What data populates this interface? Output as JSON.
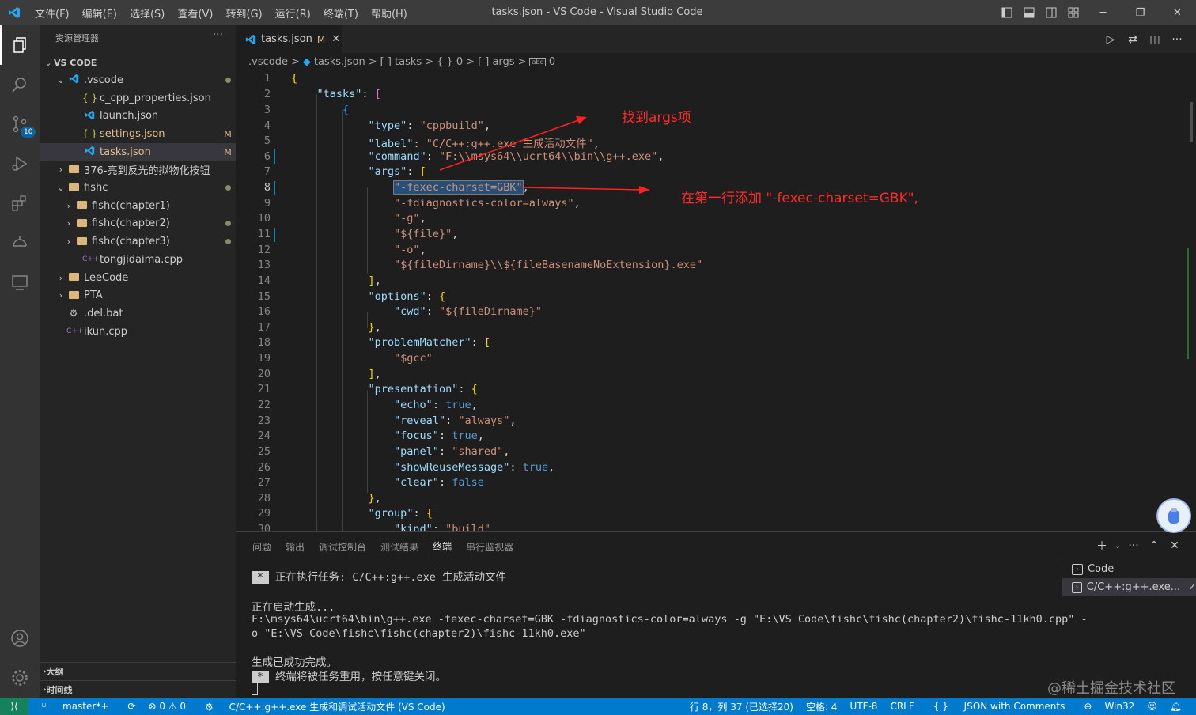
{
  "titlebar": {
    "menus": [
      "文件(F)",
      "编辑(E)",
      "选择(S)",
      "查看(V)",
      "转到(G)",
      "运行(R)",
      "终端(T)",
      "帮助(H)"
    ],
    "title": "tasks.json - VS Code - Visual Studio Code"
  },
  "activity": {
    "scm_badge": "10"
  },
  "sidebar": {
    "title": "资源管理器",
    "root": "VS CODE",
    "items": [
      {
        "label": ".vscode",
        "dec": "●"
      },
      {
        "label": "c_cpp_properties.json",
        "icon": "{ }",
        "dec": ""
      },
      {
        "label": "launch.json",
        "dec": ""
      },
      {
        "label": "settings.json",
        "icon": "{ }",
        "dec": "M"
      },
      {
        "label": "tasks.json",
        "dec": "M"
      },
      {
        "label": "376-亮到反光的拟物化按钮",
        "dec": ""
      },
      {
        "label": "fishc",
        "dec": "●"
      },
      {
        "label": "fishc(chapter1)",
        "dec": ""
      },
      {
        "label": "fishc(chapter2)",
        "dec": "●"
      },
      {
        "label": "fishc(chapter3)",
        "dec": "●"
      },
      {
        "label": "tongjidaima.cpp",
        "icon": "C++",
        "dec": ""
      },
      {
        "label": "LeeCode",
        "dec": ""
      },
      {
        "label": "PTA",
        "dec": ""
      },
      {
        "label": ".del.bat",
        "dec": ""
      },
      {
        "label": "ikun.cpp",
        "icon": "C++",
        "dec": ""
      }
    ],
    "outline": "大纲",
    "timeline": "时间线"
  },
  "tabs": [
    {
      "label": "tasks.json",
      "modified": "M"
    }
  ],
  "breadcrumb": [
    ".vscode",
    ">",
    "tasks.json",
    ">",
    "[ ] tasks",
    ">",
    "{ } 0",
    ">",
    "[ ] args",
    ">",
    "0"
  ],
  "code": {
    "line_numbers": [
      "1",
      "2",
      "3",
      "4",
      "5",
      "6",
      "7",
      "8",
      "9",
      "10",
      "11",
      "12",
      "13",
      "14",
      "15",
      "16",
      "17",
      "18",
      "19",
      "20",
      "21",
      "22",
      "23",
      "24",
      "25",
      "26",
      "27",
      "28",
      "29",
      "30"
    ],
    "current_line": "8"
  },
  "annotations": {
    "a1": "找到args项",
    "a2": "在第一行添加  \"-fexec-charset=GBK\","
  },
  "panel": {
    "tabs": [
      "问题",
      "输出",
      "调试控制台",
      "测试结果",
      "终端",
      "串行监视器"
    ],
    "active_tab": "终端",
    "terminal_lines": {
      "l1": "正在执行任务: C/C++:g++.exe 生成活动文件",
      "l2": "正在启动生成...",
      "l3": "F:\\msys64\\ucrt64\\bin\\g++.exe -fexec-charset=GBK -fdiagnostics-color=always -g \"E:\\VS Code\\fishc\\fishc(chapter2)\\fishc-11kh0.cpp\" -",
      "l4": "o \"E:\\VS Code\\fishc\\fishc(chapter2)\\fishc-11kh0.exe\"",
      "l5": "生成已成功完成。",
      "l6": "终端将被任务重用，按任意键关闭。"
    },
    "terminal_list": [
      "Code",
      "C/C++:g++.exe...",
      "✓"
    ]
  },
  "status": {
    "branch": "master*+",
    "problems": "⊗ 0 ⚠ 0",
    "task": "C/C++:g++.exe 生成和调试活动文件 (VS Code)",
    "position": "行 8，列 37 (已选择20)",
    "spaces": "空格: 4",
    "encoding": "UTF-8",
    "eol": "CRLF",
    "language": "JSON with Comments",
    "platform": "Win32"
  },
  "watermark": "@稀土掘金技术社区"
}
